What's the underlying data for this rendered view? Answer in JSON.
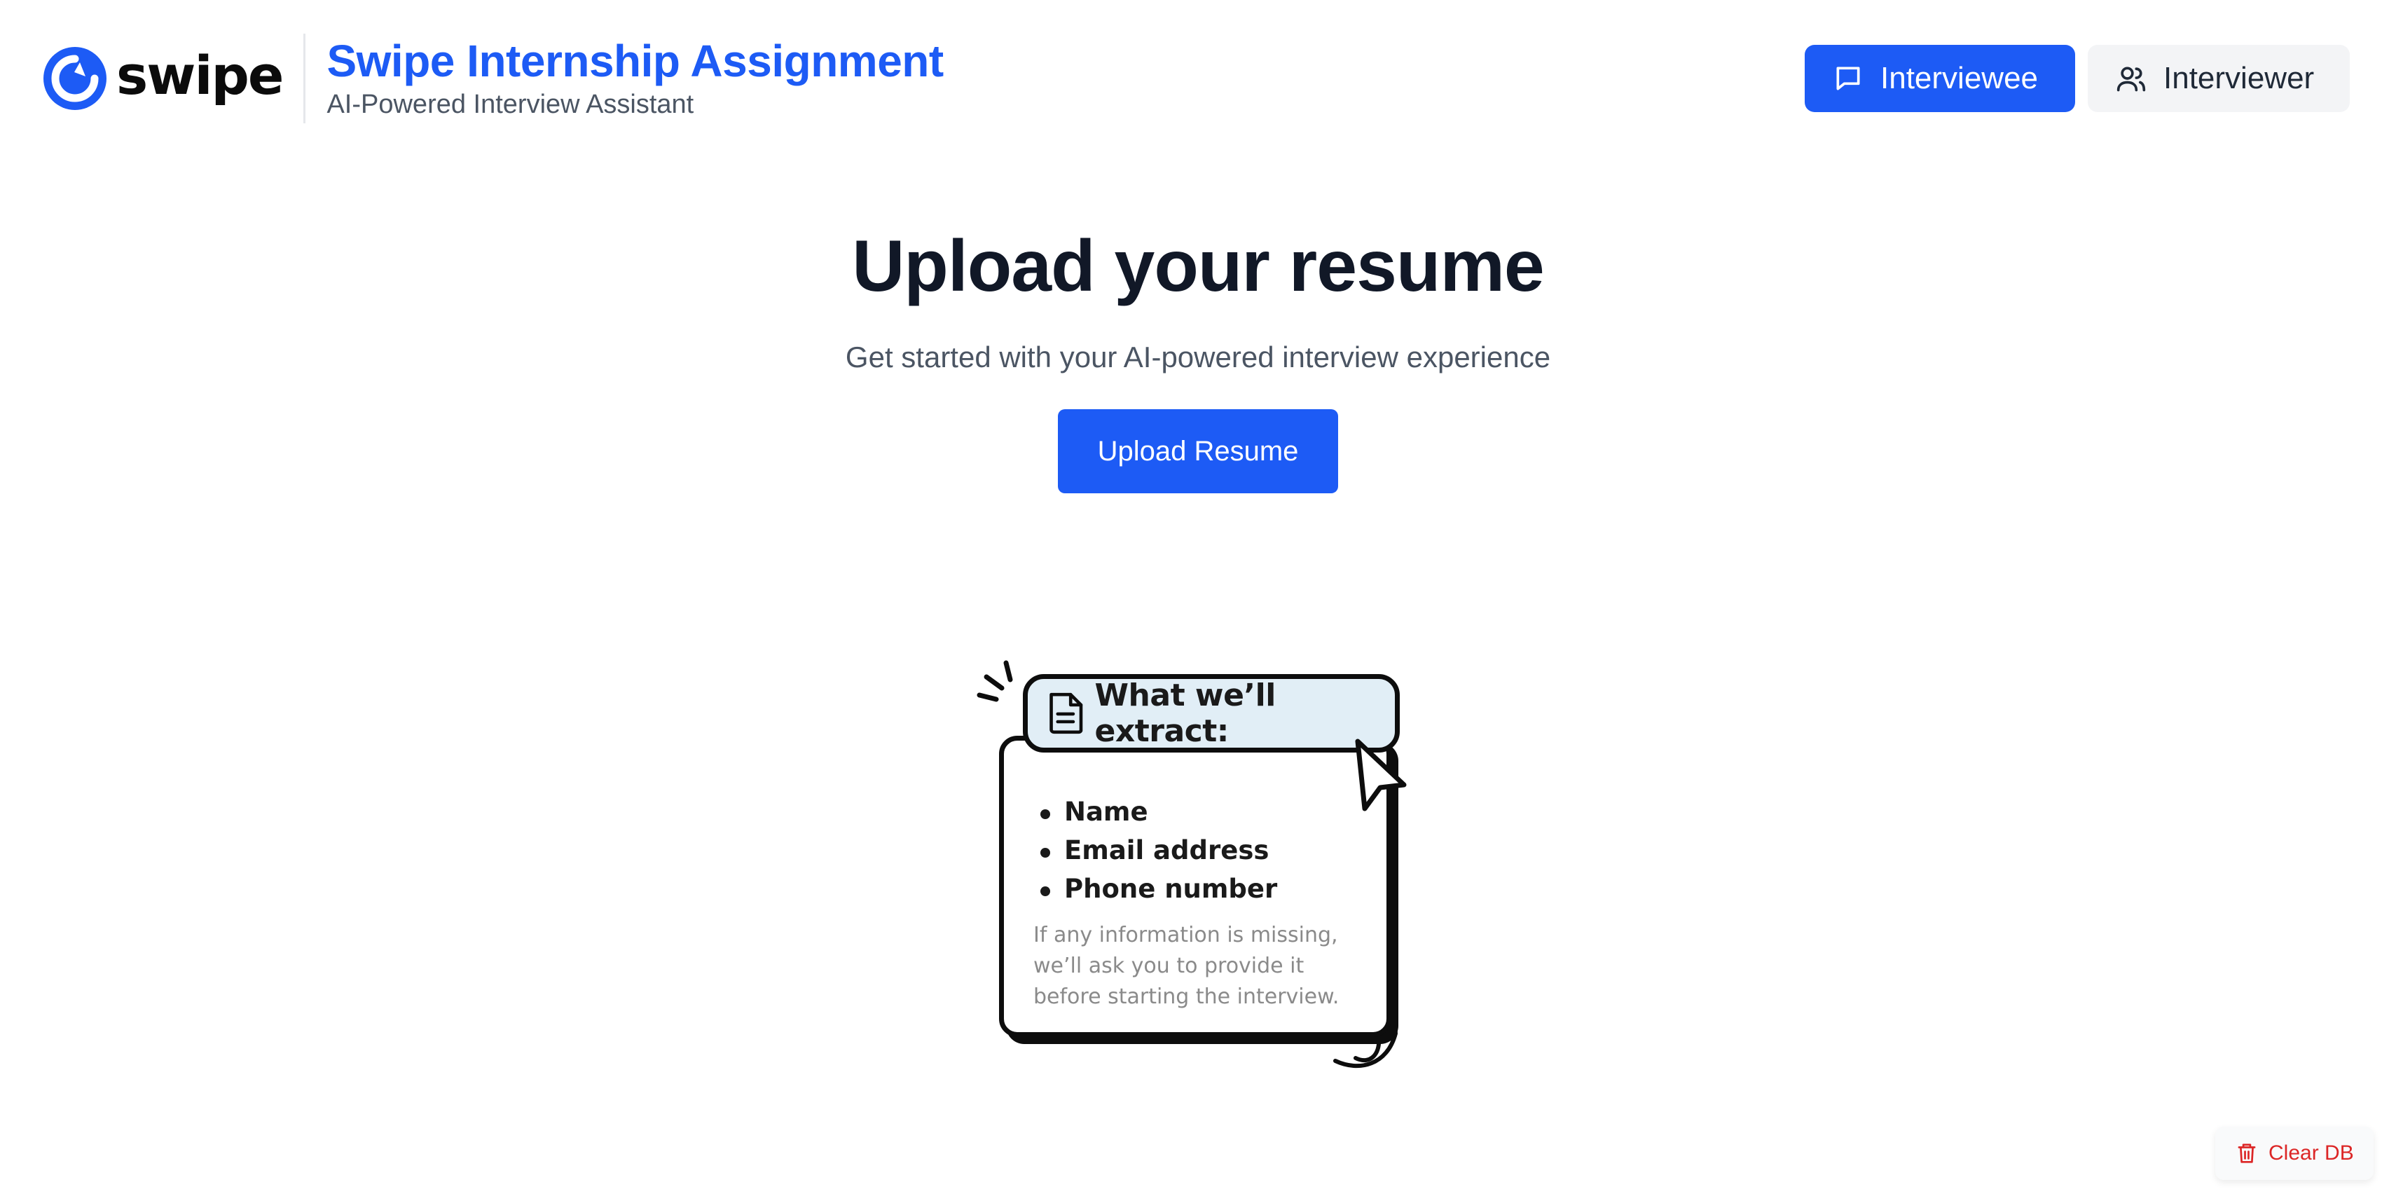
{
  "header": {
    "logo_text": "swipe",
    "title": "Swipe Internship Assignment",
    "subtitle": "AI-Powered Interview Assistant",
    "nav": [
      {
        "label": "Interviewee",
        "icon": "chat-bubble-icon",
        "active": true
      },
      {
        "label": "Interviewer",
        "icon": "users-icon",
        "active": false
      }
    ]
  },
  "hero": {
    "title": "Upload your resume",
    "subtitle": "Get started with your AI-powered interview experience",
    "upload_button": "Upload Resume"
  },
  "extract_card": {
    "title": "What we’ll extract:",
    "items": [
      "Name",
      "Email address",
      "Phone number"
    ],
    "note": "If any information is missing, we’ll ask you to provide it before starting the interview."
  },
  "clear_db": {
    "label": "Clear DB",
    "icon": "trash-icon"
  },
  "colors": {
    "brand_blue": "#1d5bf5",
    "danger_red": "#dc2626",
    "card_header_bg": "#e1eef6"
  }
}
